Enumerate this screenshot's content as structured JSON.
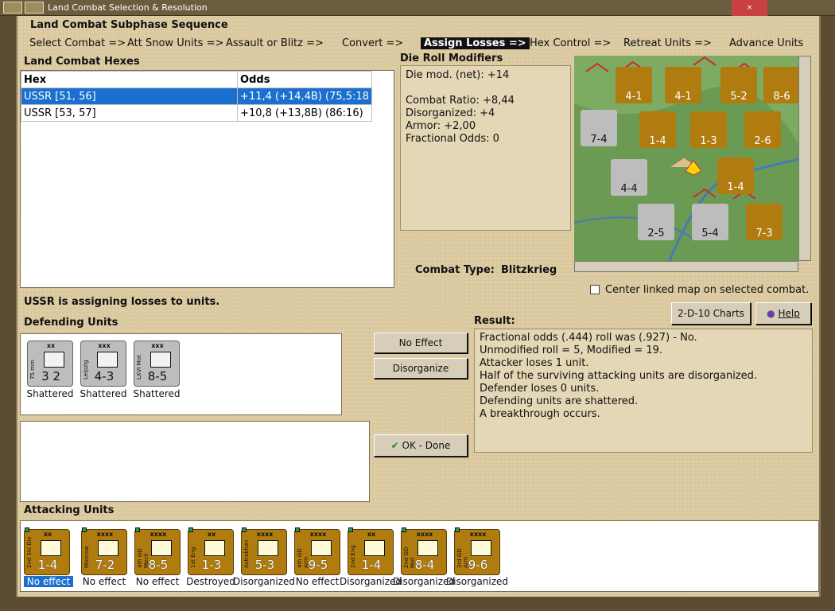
{
  "window": {
    "title": "Land Combat Selection & Resolution"
  },
  "subphase": {
    "title": "Land Combat Subphase Sequence",
    "steps": [
      "Select Combat =>",
      "Att Snow Units =>",
      "Assault or Blitz =>",
      "Convert =>",
      "Assign Losses =>",
      "Hex Control =>",
      "Retreat Units =>",
      "Advance Units"
    ],
    "active_index": 4
  },
  "hexes": {
    "title": "Land Combat Hexes",
    "columns": [
      "Hex",
      "Odds"
    ],
    "rows": [
      {
        "hex": "USSR [51, 56]",
        "odds": "+11,4 (+14,4B) (75,5:18"
      },
      {
        "hex": "USSR [53, 57]",
        "odds": "+10,8 (+13,8B) (86:16)"
      }
    ]
  },
  "modifiers": {
    "title": "Die Roll Modifiers",
    "net": "Die mod. (net): +14",
    "lines": [
      "Combat Ratio: +8,44",
      "Disorganized: +4",
      "Armor: +2,00",
      "Fractional Odds: 0"
    ]
  },
  "combat_type": {
    "label": "Combat Type:",
    "value": "Blitzkrieg"
  },
  "center_map": {
    "label": "Center linked map on selected combat.",
    "checked": false
  },
  "buttons": {
    "charts": "2-D-10 Charts",
    "help": "Help",
    "no_effect": "No Effect",
    "disorganize": "Disorganize",
    "ok": "OK - Done"
  },
  "assign_msg": "USSR is assigning losses to units.",
  "defending": {
    "title": "Defending Units",
    "units": [
      {
        "name": "75 mm",
        "size": "xx",
        "value": "3 2",
        "status": "Shattered"
      },
      {
        "name": "Leipzig",
        "size": "xxx",
        "value": "4-3",
        "status": "Shattered"
      },
      {
        "name": "LXVI Mot",
        "size": "xxx",
        "value": "8-5",
        "status": "Shattered"
      }
    ]
  },
  "result": {
    "title": "Result:",
    "lines": [
      "Fractional odds (.444) roll was (.927)  - No.",
      "Unmodified roll = 5, Modified = 19.",
      "Attacker loses 1 unit.",
      "Half of the surviving attacking units are disorganized.",
      "Defender loses 0 units.",
      "Defending units are shattered.",
      "A breakthrough occurs."
    ]
  },
  "attacking": {
    "title": "Attacking Units",
    "units": [
      {
        "name": "2nd Ski Div",
        "size": "xx",
        "value": "1-4",
        "status": "No effect",
        "selected": true
      },
      {
        "name": "Moscow",
        "size": "xxxx",
        "value": "7-2",
        "status": "No effect",
        "selected": false
      },
      {
        "name": "4th GD Mech",
        "size": "xxxx",
        "value": "8-5",
        "status": "No effect",
        "selected": false
      },
      {
        "name": "1st Eng",
        "size": "xx",
        "value": "1-3",
        "status": "Destroyed",
        "selected": false
      },
      {
        "name": "Astrakhan",
        "size": "xxxx",
        "value": "5-3",
        "status": "Disorganized",
        "selected": false
      },
      {
        "name": "4th GD Arm",
        "size": "xxxx",
        "value": "9-5",
        "status": "No effect",
        "selected": false
      },
      {
        "name": "2nd Eng",
        "size": "xx",
        "value": "1-4",
        "status": "Disorganized",
        "selected": false
      },
      {
        "name": "2nd GD Mot",
        "size": "xxxx",
        "value": "8-4",
        "status": "Disorganized",
        "selected": false
      },
      {
        "name": "3rd GD Arm",
        "size": "xxxx",
        "value": "9-6",
        "status": "Disorganized",
        "selected": false
      }
    ]
  },
  "map_units": [
    {
      "value": "4-1"
    },
    {
      "value": "4-1"
    },
    {
      "value": "5-2"
    },
    {
      "value": "8-6"
    },
    {
      "value": "7-4"
    },
    {
      "value": "1-4"
    },
    {
      "value": "1-3"
    },
    {
      "value": "2-6"
    },
    {
      "value": "4-4"
    },
    {
      "value": "1-4"
    },
    {
      "value": "2-5"
    },
    {
      "value": "5-4"
    },
    {
      "value": "7-3"
    }
  ]
}
